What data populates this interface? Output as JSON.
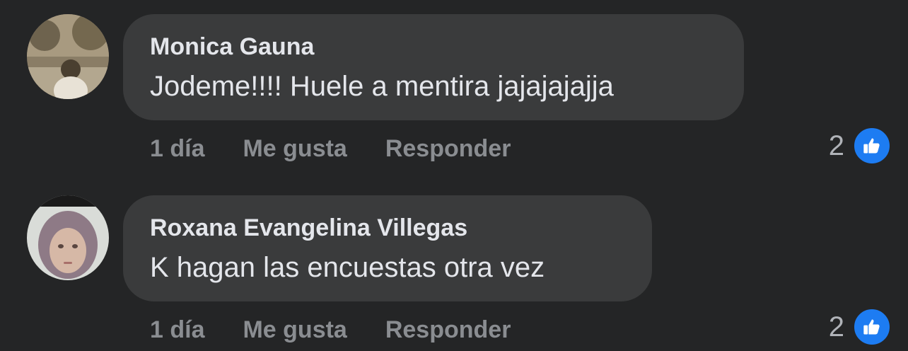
{
  "comments": [
    {
      "author": "Monica Gauna",
      "text": "Jodeme!!!! Huele a mentira jajajajajja",
      "time": "1 día",
      "like_label": "Me gusta",
      "reply_label": "Responder",
      "reaction_count": "2",
      "reaction_icon": "thumbs-up-icon"
    },
    {
      "author": "Roxana Evangelina Villegas",
      "text": "K hagan las encuestas otra vez",
      "time": "1 día",
      "like_label": "Me gusta",
      "reply_label": "Responder",
      "reaction_count": "2",
      "reaction_icon": "thumbs-up-icon"
    }
  ],
  "colors": {
    "background": "#242526",
    "bubble": "#3a3b3c",
    "primary_text": "#e4e6eb",
    "secondary_text": "#8a8d91",
    "like_blue": "#1d7cf2"
  }
}
